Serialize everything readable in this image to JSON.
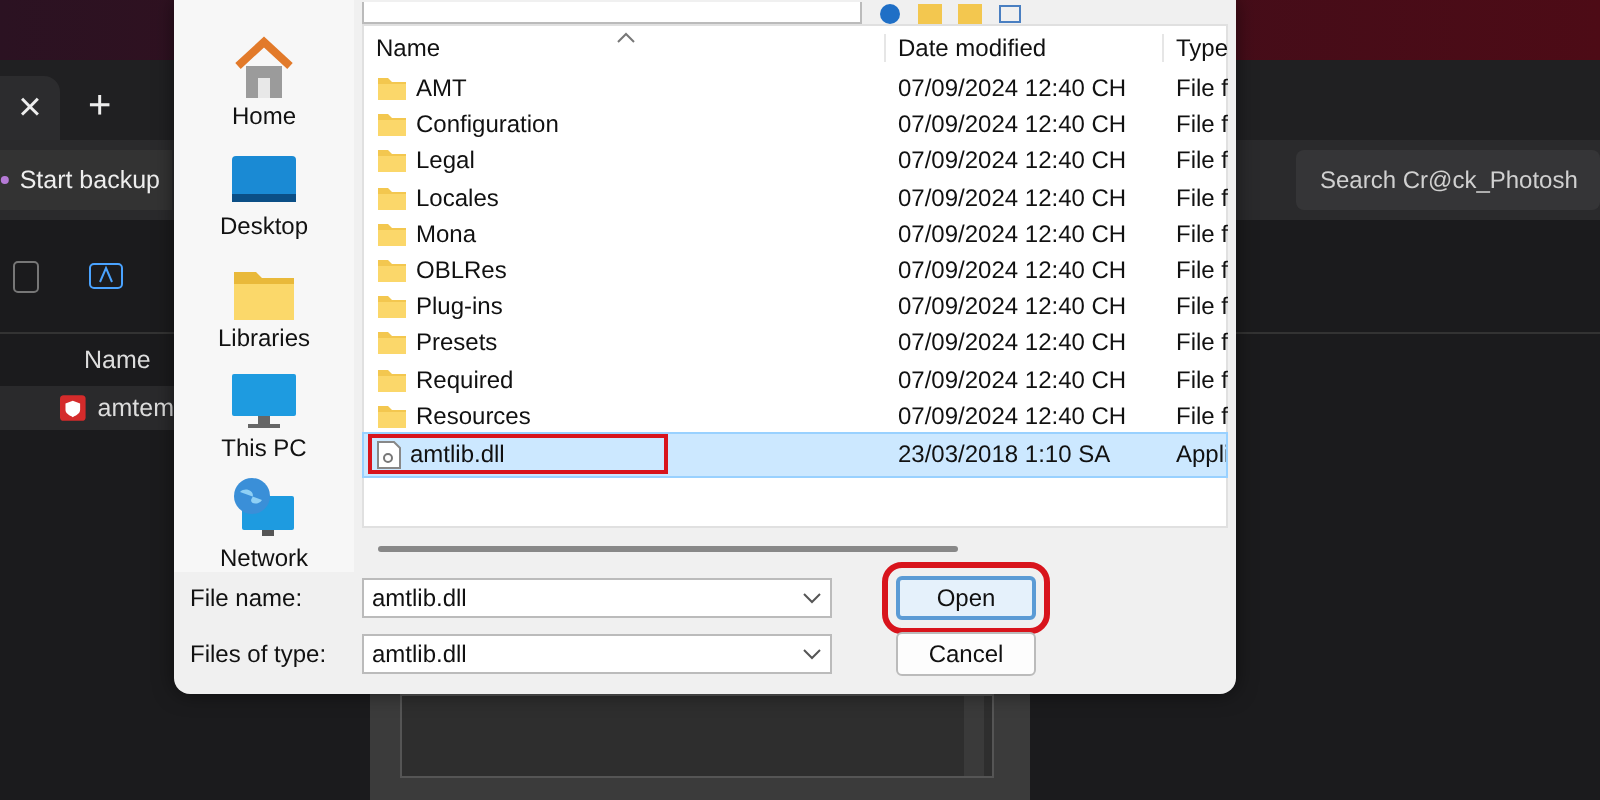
{
  "background": {
    "tab_close": "×",
    "new_tab": "+",
    "backup_button": "Start backup",
    "search": {
      "placeholder": "Search Cr@ck_Photosh"
    },
    "list_header": "Name",
    "list_row": "amtem"
  },
  "dialog": {
    "places": [
      {
        "label": "Home",
        "kind": "home"
      },
      {
        "label": "Desktop",
        "kind": "desktop"
      },
      {
        "label": "Libraries",
        "kind": "libraries"
      },
      {
        "label": "This PC",
        "kind": "pc"
      },
      {
        "label": "Network",
        "kind": "network"
      }
    ],
    "columns": [
      "Name",
      "Date modified",
      "Type"
    ],
    "rows": [
      {
        "name": "AMT",
        "date": "07/09/2024 12:40 CH",
        "type": "File f",
        "kind": "folder",
        "selected": false,
        "highlighted": false
      },
      {
        "name": "Configuration",
        "date": "07/09/2024 12:40 CH",
        "type": "File f",
        "kind": "folder",
        "selected": false,
        "highlighted": false
      },
      {
        "name": "Legal",
        "date": "07/09/2024 12:40 CH",
        "type": "File f",
        "kind": "folder",
        "selected": false,
        "highlighted": false
      },
      {
        "name": "Locales",
        "date": "07/09/2024 12:40 CH",
        "type": "File f",
        "kind": "folder",
        "selected": false,
        "highlighted": false
      },
      {
        "name": "Mona",
        "date": "07/09/2024 12:40 CH",
        "type": "File f",
        "kind": "folder",
        "selected": false,
        "highlighted": false
      },
      {
        "name": "OBLRes",
        "date": "07/09/2024 12:40 CH",
        "type": "File f",
        "kind": "folder",
        "selected": false,
        "highlighted": false
      },
      {
        "name": "Plug-ins",
        "date": "07/09/2024 12:40 CH",
        "type": "File f",
        "kind": "folder",
        "selected": false,
        "highlighted": false
      },
      {
        "name": "Presets",
        "date": "07/09/2024 12:40 CH",
        "type": "File f",
        "kind": "folder",
        "selected": false,
        "highlighted": false
      },
      {
        "name": "Required",
        "date": "07/09/2024 12:40 CH",
        "type": "File f",
        "kind": "folder",
        "selected": false,
        "highlighted": false
      },
      {
        "name": "Resources",
        "date": "07/09/2024 12:40 CH",
        "type": "File f",
        "kind": "folder",
        "selected": false,
        "highlighted": false
      },
      {
        "name": "amtlib.dll",
        "date": "23/03/2018 1:10 SA",
        "type": "Appli",
        "kind": "file",
        "selected": true,
        "highlighted": true
      }
    ],
    "file_name": {
      "label": "File name:",
      "value": "amtlib.dll"
    },
    "file_type": {
      "label": "Files of type:",
      "value": "amtlib.dll"
    },
    "buttons": [
      {
        "label": "Open",
        "default": true,
        "highlighted": true
      },
      {
        "label": "Cancel",
        "default": false,
        "highlighted": false
      }
    ]
  }
}
